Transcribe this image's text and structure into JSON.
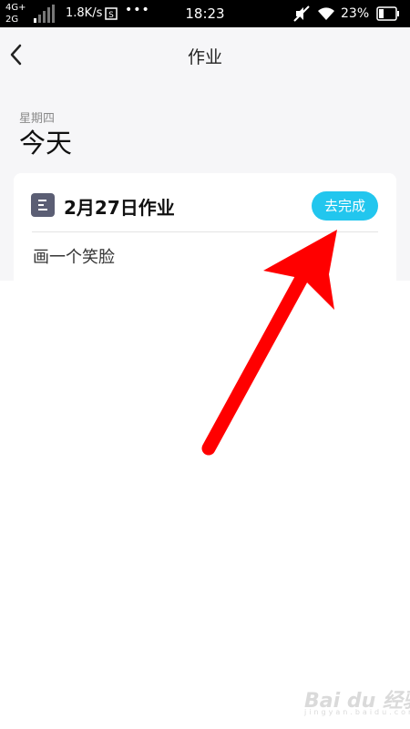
{
  "status_bar": {
    "network_top": "4G+",
    "network_bottom": "2G",
    "speed": "1.8K/s",
    "more": "•••",
    "time": "18:23",
    "battery": "23%",
    "icons": [
      "signal-bars-icon",
      "sim-card-icon",
      "mute-icon",
      "wifi-icon",
      "battery-icon"
    ]
  },
  "header": {
    "title": "作业",
    "back_icon": "chevron-left-icon"
  },
  "date": {
    "weekday": "星期四",
    "day": "今天"
  },
  "homework_card": {
    "icon": "document-icon",
    "title": "2月27日作业",
    "button_label": "去完成",
    "task": "画一个笑脸"
  },
  "annotation": {
    "icon": "red-arrow-icon",
    "color": "#ff0000"
  },
  "watermark": {
    "text": "Bai du 经验",
    "sub": "jingyan.baidu.com"
  },
  "colors": {
    "accent": "#22c6ee",
    "app_background": "#f6f6f8",
    "card_icon": "#5b5e74"
  }
}
